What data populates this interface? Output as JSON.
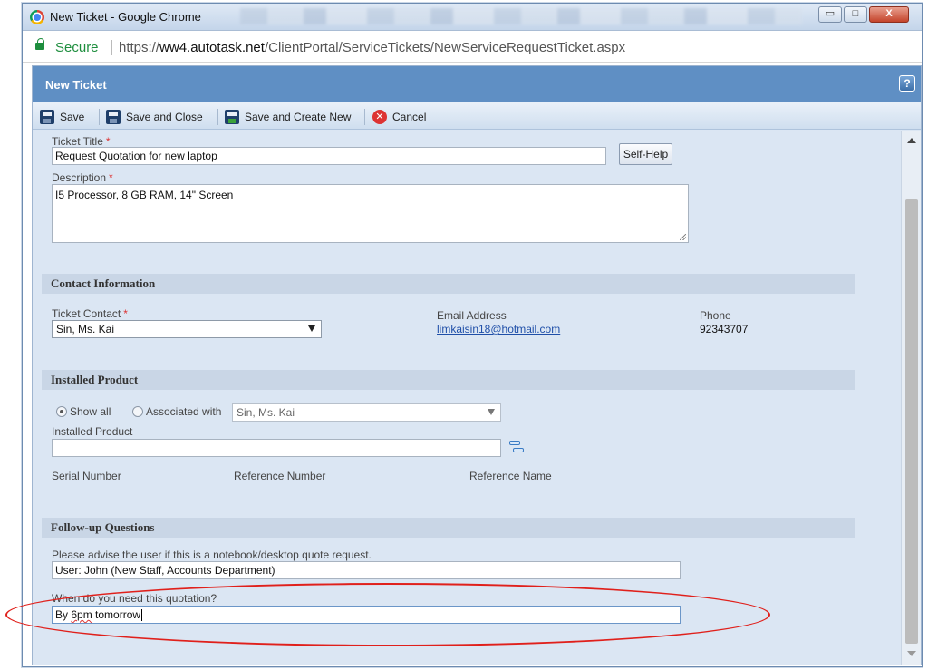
{
  "window": {
    "title": "New Ticket - Google Chrome",
    "controls": {
      "minimize": "▭",
      "maximize": "□",
      "close": "X"
    }
  },
  "address_bar": {
    "secure_label": "Secure",
    "url_scheme": "https://",
    "url_domain": "ww4.autotask.net",
    "url_path": "/ClientPortal/ServiceTickets/NewServiceRequestTicket.aspx"
  },
  "app": {
    "title": "New Ticket",
    "help": "?"
  },
  "toolbar": {
    "save": "Save",
    "save_close": "Save and Close",
    "save_new": "Save and Create New",
    "cancel": "Cancel"
  },
  "form": {
    "ticket_title_label": "Ticket Title",
    "ticket_title_value": "Request Quotation for new laptop",
    "self_help": "Self-Help",
    "description_label": "Description",
    "description_value": "I5 Processor, 8 GB RAM, 14\" Screen",
    "required_mark": "*"
  },
  "contact": {
    "section_title": "Contact Information",
    "ticket_contact_label": "Ticket Contact",
    "ticket_contact_value": "Sin, Ms. Kai",
    "email_label": "Email Address",
    "email_value": "limkaisin18@hotmail.com",
    "phone_label": "Phone",
    "phone_value": "92343707"
  },
  "installed_product": {
    "section_title": "Installed Product",
    "radio_show_all": "Show all",
    "radio_associated": "Associated with",
    "associated_value": "Sin, Ms. Kai",
    "product_label": "Installed Product",
    "serial_label": "Serial Number",
    "reference_number_label": "Reference Number",
    "reference_name_label": "Reference Name"
  },
  "followup": {
    "section_title": "Follow-up Questions",
    "q1_label": "Please advise the user if this is a notebook/desktop quote request.",
    "q1_value": "User: John (New Staff, Accounts Department)",
    "q2_label": "When do you need this quotation?",
    "q2_value_prefix": "By ",
    "q2_value_word": "6pm",
    "q2_value_suffix": " tomorrow"
  },
  "colors": {
    "header_blue": "#5f8fc4",
    "panel_bg": "#dbe6f3",
    "highlight_red": "#e0201b",
    "secure_green": "#1e8e3e"
  }
}
